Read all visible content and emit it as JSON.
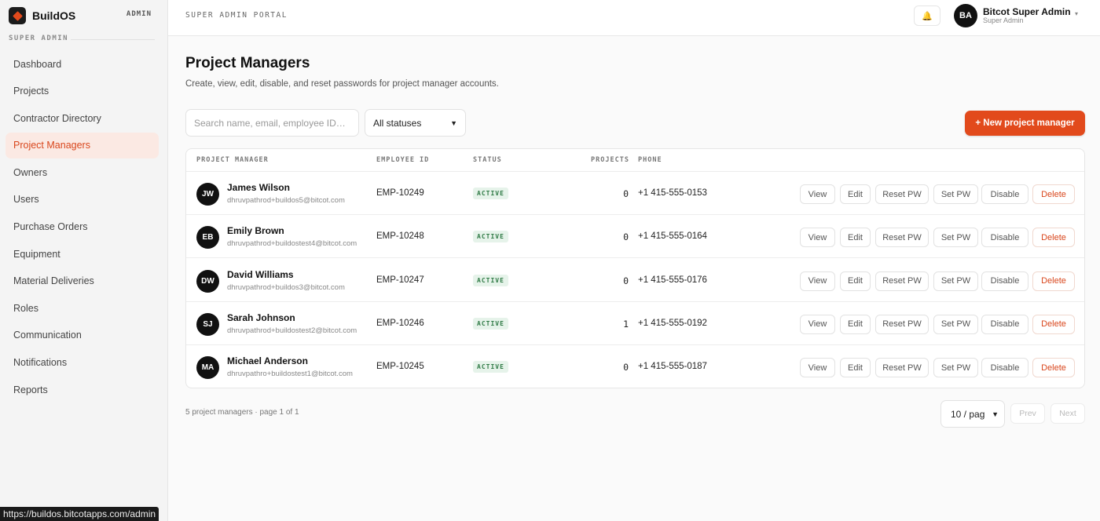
{
  "app": {
    "name": "BuildOS",
    "badge": "ADMIN",
    "section": "SUPER ADMIN"
  },
  "sidebar": {
    "items": [
      {
        "label": "Dashboard",
        "active": false
      },
      {
        "label": "Projects",
        "active": false
      },
      {
        "label": "Contractor Directory",
        "active": false
      },
      {
        "label": "Project Managers",
        "active": true
      },
      {
        "label": "Owners",
        "active": false
      },
      {
        "label": "Users",
        "active": false
      },
      {
        "label": "Purchase Orders",
        "active": false
      },
      {
        "label": "Equipment",
        "active": false
      },
      {
        "label": "Material Deliveries",
        "active": false
      },
      {
        "label": "Roles",
        "active": false
      },
      {
        "label": "Communication",
        "active": false
      },
      {
        "label": "Notifications",
        "active": false
      },
      {
        "label": "Reports",
        "active": false
      }
    ]
  },
  "header": {
    "portal_title": "SUPER ADMIN PORTAL",
    "bell_icon": "bell-icon",
    "user": {
      "initials": "BA",
      "name": "Bitcot Super Admin",
      "role": "Super Admin"
    },
    "caret": "▾"
  },
  "main": {
    "title": "Project Managers",
    "subtitle": "Create, view, edit, disable, and reset passwords for project manager accounts.",
    "search_placeholder": "Search name, email, employee ID…",
    "status_filter": "All statuses",
    "new_button": "+ New project manager",
    "accent_color": "#e24a1c"
  },
  "table": {
    "columns": {
      "manager": "PROJECT MANAGER",
      "employee_id": "EMPLOYEE ID",
      "status": "STATUS",
      "projects": "PROJECTS",
      "phone": "PHONE"
    },
    "actions": [
      "View",
      "Edit",
      "Reset PW",
      "Set PW",
      "Disable",
      "Delete"
    ],
    "rows": [
      {
        "initials": "JW",
        "name": "James Wilson",
        "email": "dhruvpathrod+buildos5@bitcot.com",
        "employee_id": "EMP-10249",
        "status": "ACTIVE",
        "projects": "0",
        "phone": "+1 415-555-0153"
      },
      {
        "initials": "EB",
        "name": "Emily Brown",
        "email": "dhruvpathrod+buildostest4@bitcot.com",
        "employee_id": "EMP-10248",
        "status": "ACTIVE",
        "projects": "0",
        "phone": "+1 415-555-0164"
      },
      {
        "initials": "DW",
        "name": "David Williams",
        "email": "dhruvpathrod+buildos3@bitcot.com",
        "employee_id": "EMP-10247",
        "status": "ACTIVE",
        "projects": "0",
        "phone": "+1 415-555-0176"
      },
      {
        "initials": "SJ",
        "name": "Sarah Johnson",
        "email": "dhruvpathrod+buildostest2@bitcot.com",
        "employee_id": "EMP-10246",
        "status": "ACTIVE",
        "projects": "1",
        "phone": "+1 415-555-0192"
      },
      {
        "initials": "MA",
        "name": "Michael Anderson",
        "email": "dhruvpathro+buildostest1@bitcot.com",
        "employee_id": "EMP-10245",
        "status": "ACTIVE",
        "projects": "0",
        "phone": "+1 415-555-0187"
      }
    ]
  },
  "footer": {
    "count_text": "5 project managers · page 1 of 1",
    "per_page": "10 / pag",
    "prev": "Prev",
    "next": "Next"
  },
  "status_bar": {
    "url": "https://buildos.bitcotapps.com/admin"
  }
}
